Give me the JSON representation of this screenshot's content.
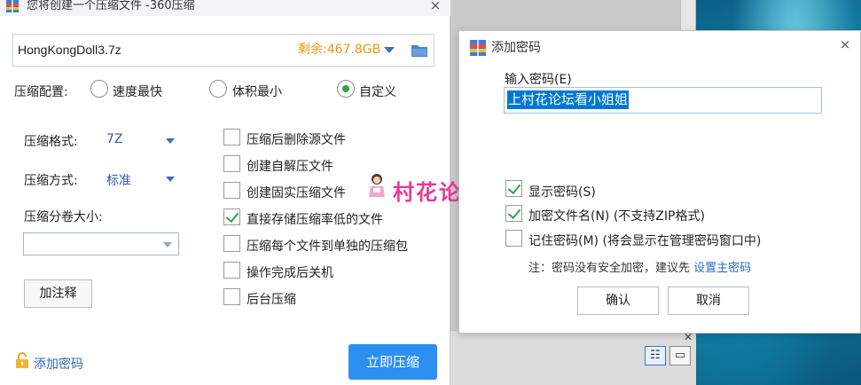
{
  "main_window": {
    "title": "您将创建一个压缩文件 -360压缩",
    "close": "×",
    "path": {
      "filename": "HongKongDoll3.7z",
      "free_space": "剩余:467.8GB"
    },
    "config": {
      "label": "压缩配置:",
      "options": [
        "速度最快",
        "体积最小",
        "自定义"
      ],
      "selected": "自定义"
    },
    "format": {
      "label": "压缩格式:",
      "value": "7Z"
    },
    "method": {
      "label": "压缩方式:",
      "value": "标准"
    },
    "volume": {
      "label": "压缩分卷大小:",
      "value": ""
    },
    "comment_button": "加注释",
    "options": [
      {
        "label": "压缩后删除源文件",
        "checked": false
      },
      {
        "label": "创建自解压文件",
        "checked": false
      },
      {
        "label": "创建固实压缩文件",
        "checked": false
      },
      {
        "label": "直接存储压缩率低的文件",
        "checked": true
      },
      {
        "label": "压缩每个文件到单独的压缩包",
        "checked": false
      },
      {
        "label": "操作完成后关机",
        "checked": false
      },
      {
        "label": "后台压缩",
        "checked": false
      }
    ],
    "add_password": "添加密码",
    "compress_now": "立即压缩"
  },
  "password_dialog": {
    "title": "添加密码",
    "close": "×",
    "input_label": "输入密码(E)",
    "password": "上村花论坛看小姐姐",
    "options": [
      {
        "label": "显示密码(S)",
        "checked": true
      },
      {
        "label": "加密文件名(N) (不支持ZIP格式)",
        "checked": true
      },
      {
        "label": "记住密码(M) (将会显示在管理密码窗口中)",
        "checked": false
      }
    ],
    "note": "注：密码没有安全加密，建议先",
    "note_link": "设置主密码",
    "ok": "确认",
    "cancel": "取消"
  },
  "watermark": "村花论坛",
  "colors": {
    "accent_blue": "#2d8ff0",
    "free_space_orange": "#f0960e",
    "check_green": "#29a745",
    "link_blue": "#2a6bc0",
    "watermark_pink": "#e8399a"
  }
}
